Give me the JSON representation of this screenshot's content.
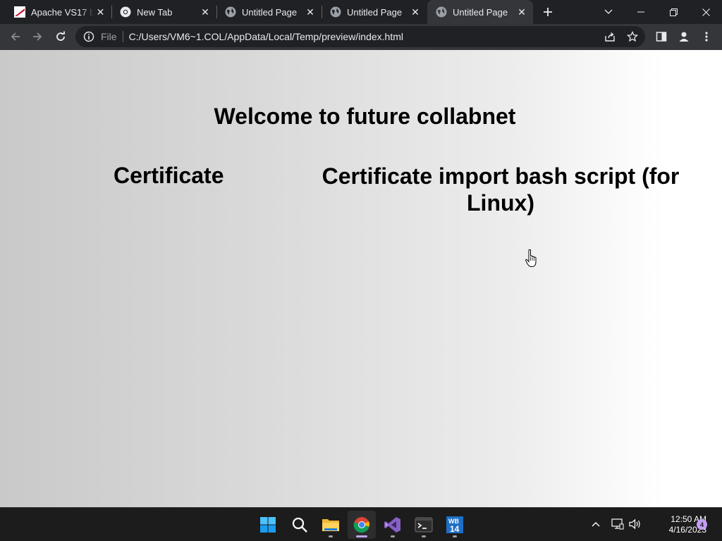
{
  "browser": {
    "tabs": [
      {
        "title": "Apache VS17 bi",
        "favicon": "apache-feather-icon",
        "active": false
      },
      {
        "title": "New Tab",
        "favicon": "chrome-icon",
        "active": false
      },
      {
        "title": "Untitled Page",
        "favicon": "globe-icon",
        "active": false
      },
      {
        "title": "Untitled Page",
        "favicon": "globe-icon",
        "active": false
      },
      {
        "title": "Untitled Page",
        "favicon": "globe-icon",
        "active": true
      }
    ],
    "close_glyph": "✕",
    "new_tab_glyph": "+",
    "address": {
      "scheme_label": "File",
      "url": "C:/Users/VM6~1.COL/AppData/Local/Temp/preview/index.html"
    }
  },
  "page": {
    "heading": "Welcome to future collabnet",
    "links": [
      {
        "text": "Certificate"
      },
      {
        "text": "Certificate import bash script (for Linux)"
      }
    ],
    "background_gradient": [
      "#c9c9c9",
      "#ffffff"
    ]
  },
  "taskbar": {
    "apps": [
      {
        "name": "start-icon",
        "active": false
      },
      {
        "name": "search-icon",
        "active": false
      },
      {
        "name": "file-explorer-icon",
        "active": false
      },
      {
        "name": "chrome-icon",
        "active": true
      },
      {
        "name": "visual-studio-icon",
        "active": false
      },
      {
        "name": "terminal-icon",
        "active": false
      },
      {
        "name": "webmatrix-icon",
        "active": false
      }
    ],
    "clock": {
      "time": "12:50 AM",
      "date": "4/16/2023"
    },
    "notification_count": "4"
  },
  "colors": {
    "titlebar": "#202124",
    "toolbar": "#35363a",
    "taskbar": "#1c1c1c",
    "accent": "#c39df5"
  }
}
